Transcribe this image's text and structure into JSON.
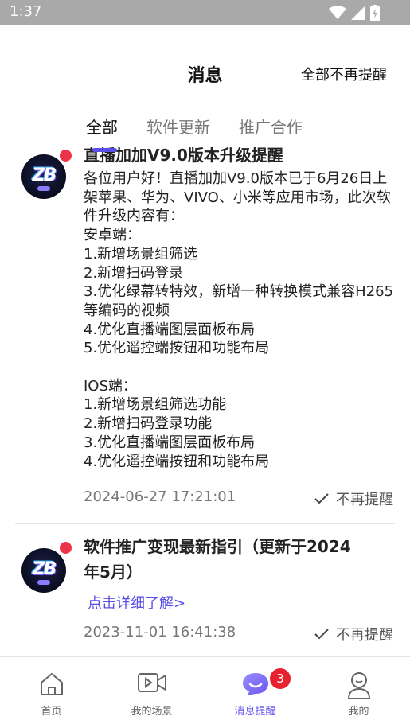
{
  "status_bar": {
    "time": "1:37"
  },
  "header": {
    "title": "消息",
    "mute_all": "全部不再提醒"
  },
  "tabs": [
    {
      "label": "全部",
      "active": true
    },
    {
      "label": "软件更新",
      "active": false
    },
    {
      "label": "推广合作",
      "active": false
    }
  ],
  "messages": [
    {
      "title": "直播加加V9.0版本升级提醒",
      "body": "各位用户好！直播加加V9.0版本已于6月26日上架苹果、华为、VIVO、小米等应用市场，此次软件升级内容有：\n安卓端：\n1.新增场景组筛选\n2.新增扫码登录\n3.优化绿幕转特效，新增一种转换模式兼容H265等编码的视频\n4.优化直播端图层面板布局\n5.优化遥控端按钮和功能布局\n\nIOS端：\n1.新增场景组筛选功能\n2.新增扫码登录功能\n3.优化直播端图层面板布局\n4.优化遥控端按钮和功能布局",
      "time": "2024-06-27 17:21:01",
      "dismiss": "不再提醒",
      "unread": true
    },
    {
      "title": "软件推广变现最新指引（更新于2024年5月）",
      "link": "点击详细了解>",
      "time": "2023-11-01 16:41:38",
      "dismiss": "不再提醒",
      "unread": true
    }
  ],
  "avatar_text": "ZB",
  "bottom_nav": [
    {
      "label": "首页",
      "icon": "home-icon",
      "active": false
    },
    {
      "label": "我的场景",
      "icon": "video-camera-icon",
      "active": false
    },
    {
      "label": "消息提醒",
      "icon": "chat-bubble-icon",
      "active": true,
      "badge": "3"
    },
    {
      "label": "我的",
      "icon": "user-icon",
      "active": false
    }
  ],
  "colors": {
    "accent": "#5a4ee8",
    "badge": "#e8212f",
    "unread_dot": "#f0314a",
    "status_bar": "#a9a9a9"
  }
}
